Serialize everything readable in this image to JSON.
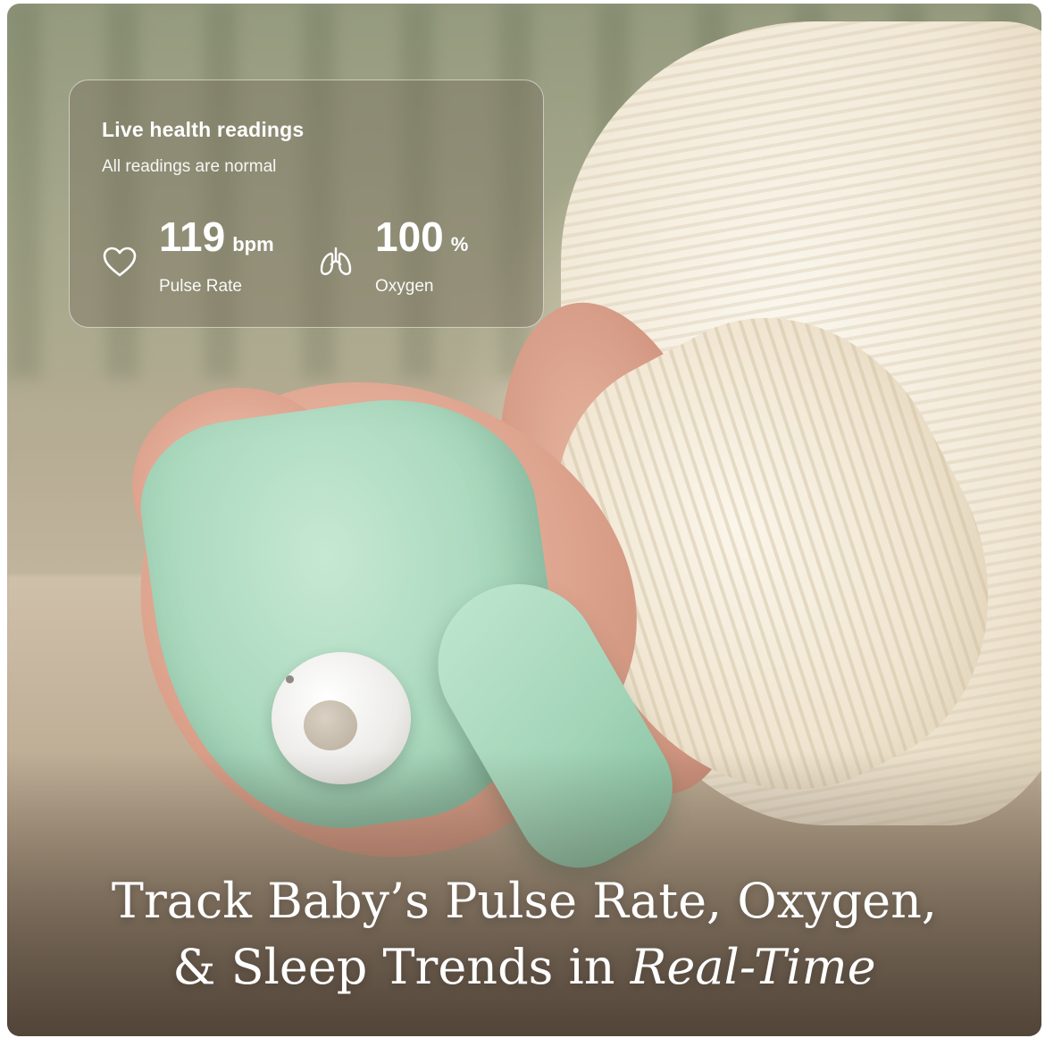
{
  "card": {
    "title": "Live health readings",
    "subtitle": "All readings are normal",
    "pulse": {
      "value": "119",
      "unit": "bpm",
      "label": "Pulse Rate",
      "icon": "heart-icon"
    },
    "oxygen": {
      "value": "100",
      "unit": "%",
      "label": "Oxygen",
      "icon": "lungs-icon"
    }
  },
  "headline": {
    "line1": "Track Baby’s Pulse Rate, Oxygen,",
    "line2_prefix": "& Sleep Trends in ",
    "line2_emphasis": "Real-Time"
  },
  "colors": {
    "sock_mint": "#a9d8bd",
    "sweater_cream": "#f1e8d6",
    "card_border": "#ffffff"
  }
}
